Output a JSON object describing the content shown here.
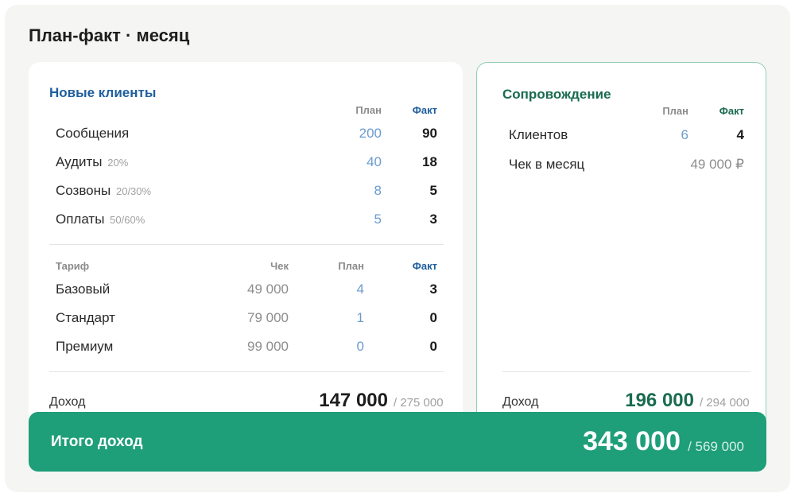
{
  "page_title": "План-факт · месяц",
  "new_clients": {
    "title": "Новые клиенты",
    "header": {
      "plan": "План",
      "fact": "Факт"
    },
    "funnel": [
      {
        "label": "Сообщения",
        "sub": "",
        "plan": "200",
        "fact": "90"
      },
      {
        "label": "Аудиты",
        "sub": "20%",
        "plan": "40",
        "fact": "18"
      },
      {
        "label": "Созвоны",
        "sub": "20/30%",
        "plan": "8",
        "fact": "5"
      },
      {
        "label": "Оплаты",
        "sub": "50/60%",
        "plan": "5",
        "fact": "3"
      }
    ],
    "tariff_header": {
      "tariff": "Тариф",
      "check": "Чек",
      "plan": "План",
      "fact": "Факт"
    },
    "tariffs": [
      {
        "name": "Базовый",
        "check": "49 000",
        "plan": "4",
        "fact": "3"
      },
      {
        "name": "Стандарт",
        "check": "79 000",
        "plan": "1",
        "fact": "0"
      },
      {
        "name": "Премиум",
        "check": "99 000",
        "plan": "0",
        "fact": "0"
      }
    ],
    "income": {
      "label": "Доход",
      "value": "147 000",
      "of": "/ 275 000"
    }
  },
  "support": {
    "title": "Сопровождение",
    "header": {
      "plan": "План",
      "fact": "Факт"
    },
    "clients": {
      "label": "Клиентов",
      "plan": "6",
      "fact": "4"
    },
    "check": {
      "label": "Чек в месяц",
      "value": "49 000 ₽"
    },
    "income": {
      "label": "Доход",
      "value": "196 000",
      "of": "/ 294 000"
    }
  },
  "total": {
    "label": "Итого доход",
    "value": "343 000",
    "of": "/ 569 000"
  },
  "colors": {
    "blue_accent": "#1f5f9e",
    "green_accent": "#1a6b4f",
    "total_bg": "#1e9e79",
    "plan_value": "#6b9ccd"
  }
}
